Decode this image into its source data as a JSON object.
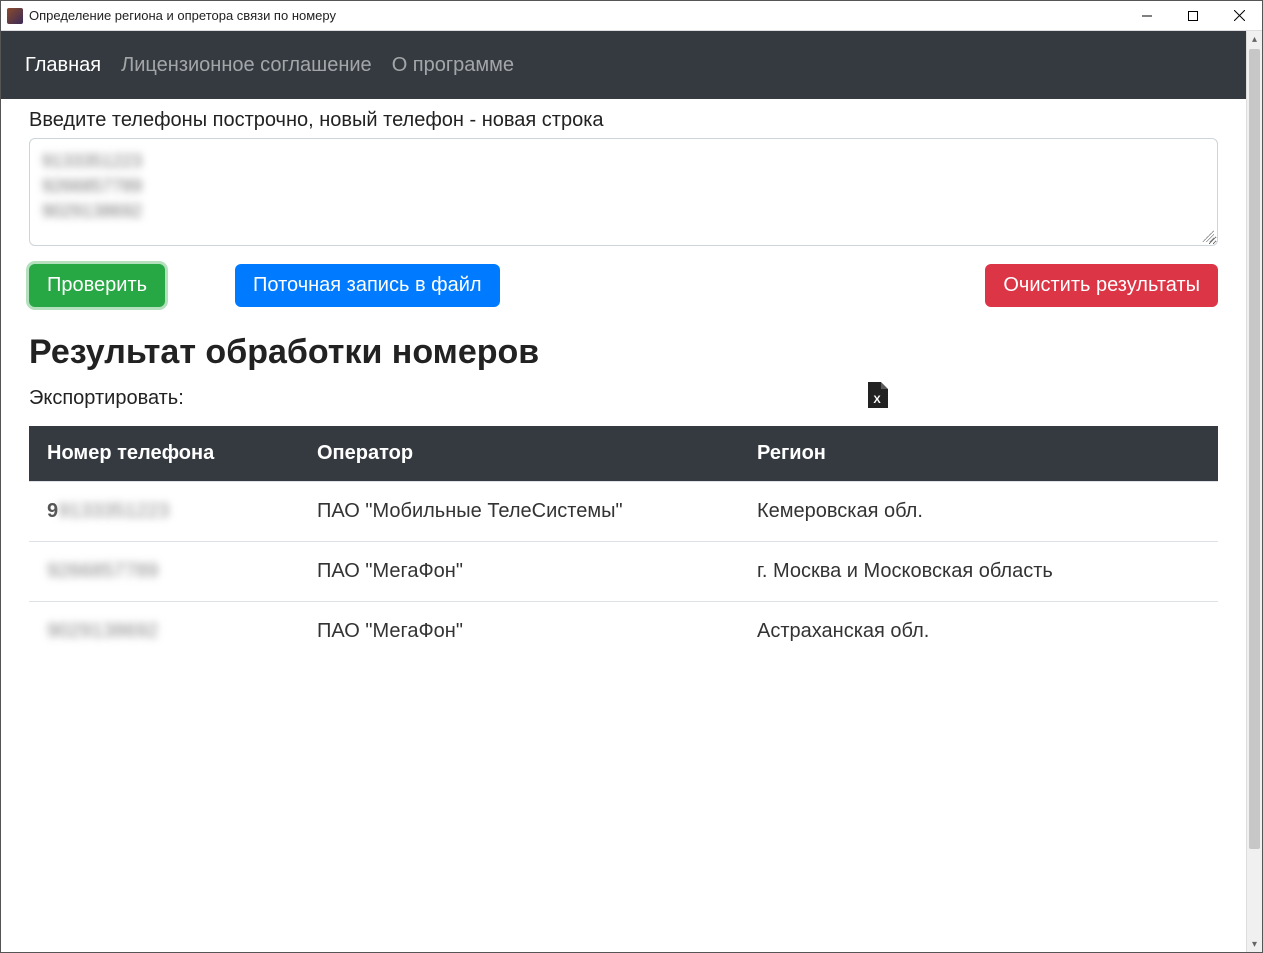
{
  "window": {
    "title": "Определение региона и опретора связи по номеру"
  },
  "nav": {
    "items": [
      {
        "label": "Главная",
        "active": true
      },
      {
        "label": "Лицензионное соглашение",
        "active": false
      },
      {
        "label": "О программе",
        "active": false
      }
    ]
  },
  "input": {
    "label": "Введите телефоны построчно, новый телефон - новая строка",
    "lines": [
      "9133351223",
      "9266857789",
      "9029138692"
    ]
  },
  "buttons": {
    "check": "Проверить",
    "stream_write": "Поточная запись в файл",
    "clear": "Очистить результаты"
  },
  "results": {
    "title": "Результат обработки номеров",
    "export_label": "Экспортировать:",
    "columns": [
      "Номер телефона",
      "Оператор",
      "Регион"
    ],
    "rows": [
      {
        "phone": "9133351223",
        "operator": "ПАО \"Мобильные ТелеСистемы\"",
        "region": "Кемеровская обл."
      },
      {
        "phone": "9266857789",
        "operator": "ПАО \"МегаФон\"",
        "region": "г. Москва и Московская область"
      },
      {
        "phone": "9029138692",
        "operator": "ПАО \"МегаФон\"",
        "region": "Астраханская обл."
      }
    ]
  }
}
